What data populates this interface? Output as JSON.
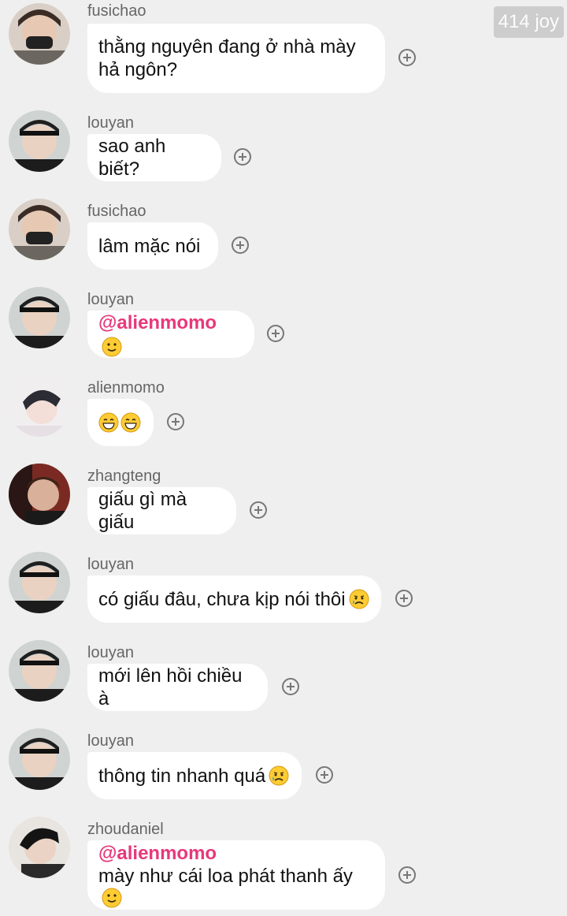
{
  "watermark": "414 joy",
  "messages": [
    {
      "user": "fusichao",
      "text": "thằng nguyên đang ở nhà mày hả ngôn?",
      "mention": "",
      "emoji": ""
    },
    {
      "user": "louyan",
      "text": "sao anh biết?",
      "mention": "",
      "emoji": ""
    },
    {
      "user": "fusichao",
      "text": "lâm mặc nói",
      "mention": "",
      "emoji": ""
    },
    {
      "user": "louyan",
      "text": "",
      "mention": "@alienmomo",
      "emoji": "slightly-smiling-face"
    },
    {
      "user": "alienmomo",
      "text": "",
      "mention": "",
      "emoji": "grinning-face-x2"
    },
    {
      "user": "zhangteng",
      "text": "giấu gì mà giấu",
      "mention": "",
      "emoji": ""
    },
    {
      "user": "louyan",
      "text": "có giấu đâu, chưa kịp nói thôi",
      "mention": "",
      "emoji": "sad-tear-face"
    },
    {
      "user": "louyan",
      "text": "mới lên hồi chiều à",
      "mention": "",
      "emoji": ""
    },
    {
      "user": "louyan",
      "text": "thông tin nhanh quá",
      "mention": "",
      "emoji": "sad-tear-face"
    },
    {
      "user": "zhoudaniel",
      "text": "mày như cái loa phát thanh ấy",
      "mention": "@alienmomo",
      "emoji": "slightly-smiling-face"
    }
  ],
  "colors": {
    "background": "#efefef",
    "bubble": "#ffffff",
    "mention": "#e8387a",
    "username": "#666666"
  }
}
